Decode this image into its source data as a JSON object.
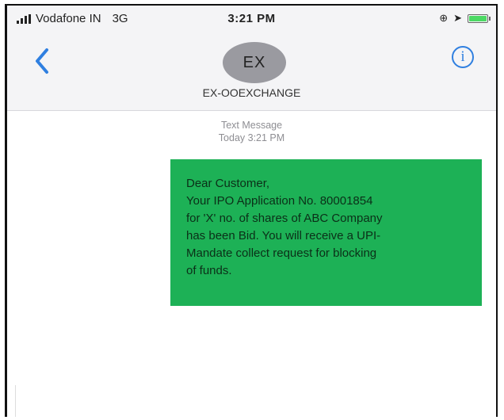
{
  "status_bar": {
    "carrier": "Vodafone IN",
    "network": "3G",
    "time": "3:21 PM"
  },
  "nav": {
    "avatar_initials": "EX",
    "contact_name": "EX-OOEXCHANGE",
    "info_label": "i"
  },
  "thread": {
    "meta_type": "Text Message",
    "meta_time": "Today 3:21 PM",
    "message_lines": [
      "Dear Customer,",
      "Your IPO Application No. 80001854",
      "for 'X' no. of shares of ABC Company",
      "has been Bid. You will receive a UPI-",
      "Mandate collect request for blocking",
      "of funds."
    ]
  },
  "colors": {
    "accent": "#2f7fe0",
    "bubble": "#1db156",
    "avatar": "#9a9aa0"
  }
}
